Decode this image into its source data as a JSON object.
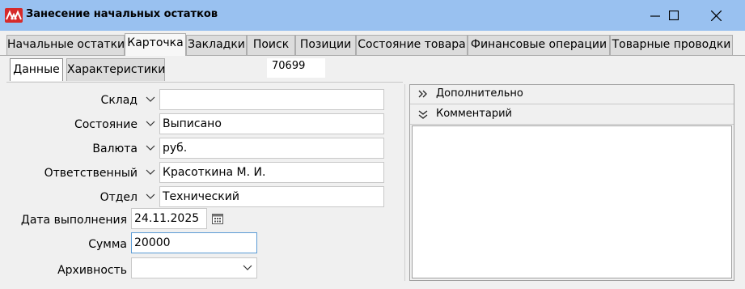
{
  "window": {
    "title": "Занесение начальных остатков"
  },
  "tabs": [
    {
      "label": "Начальные остатки"
    },
    {
      "label": "Карточка",
      "active": true
    },
    {
      "label": "Закладки"
    },
    {
      "label": "Поиск"
    },
    {
      "label": "Позиции"
    },
    {
      "label": "Состояние товара"
    },
    {
      "label": "Финансовые операции"
    },
    {
      "label": "Товарные проводки"
    }
  ],
  "subtabs": [
    {
      "label": "Данные",
      "active": true
    },
    {
      "label": "Характеристики"
    }
  ],
  "doc_number": "70699",
  "form": {
    "warehouse": {
      "label": "Склад",
      "value": ""
    },
    "state": {
      "label": "Состояние",
      "value": "Выписано"
    },
    "currency": {
      "label": "Валюта",
      "value": "руб."
    },
    "responsible": {
      "label": "Ответственный",
      "value": "Красоткина М. И."
    },
    "department": {
      "label": "Отдел",
      "value": "Технический"
    },
    "exec_date": {
      "label": "Дата выполнения",
      "value": "24.11.2025"
    },
    "sum": {
      "label": "Сумма",
      "value": "20000"
    },
    "archive": {
      "label": "Архивность",
      "value": ""
    }
  },
  "right_panel": {
    "additional": "Дополнительно",
    "comment": "Комментарий"
  },
  "icons": {
    "app": "app-logo-icon",
    "minimize": "minimize-icon",
    "maximize": "maximize-icon",
    "close": "close-icon",
    "dropdown": "chevron-down-icon",
    "calendar": "calendar-icon",
    "expand": "double-chevron-right-icon",
    "collapse": "double-chevron-down-icon"
  },
  "colors": {
    "titlebar": "#99c1f0",
    "app_icon": "#d62a2a",
    "focus_border": "#5b9bd5"
  }
}
